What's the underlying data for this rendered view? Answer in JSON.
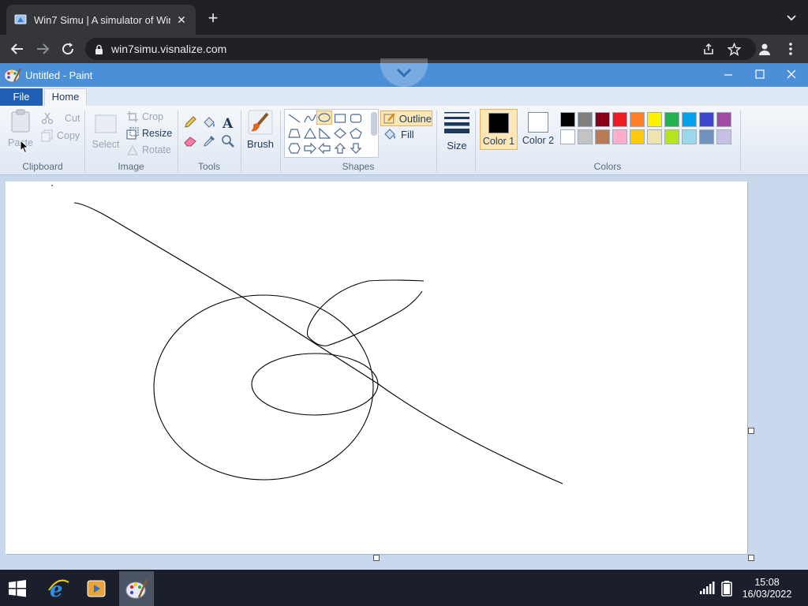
{
  "browser": {
    "tab_title": "Win7 Simu | A simulator of Win",
    "tab_close": "✕",
    "new_tab": "+",
    "url": "win7simu.visnalize.com"
  },
  "paint": {
    "window_title": "Untitled - Paint",
    "menu": {
      "file": "File",
      "home": "Home"
    },
    "clipboard": {
      "paste": "Paste",
      "cut": "Cut",
      "copy": "Copy",
      "label": "Clipboard"
    },
    "image": {
      "select": "Select",
      "crop": "Crop",
      "resize": "Resize",
      "rotate": "Rotate",
      "label": "Image"
    },
    "tools": {
      "label": "Tools"
    },
    "brush": {
      "label": "Brush"
    },
    "shapes": {
      "label": "Shapes",
      "outline": "Outline",
      "fill": "Fill"
    },
    "size": {
      "label": "Size"
    },
    "colors": {
      "color1_label": "Color 1",
      "color2_label": "Color 2",
      "label": "Colors",
      "color1": "#000000",
      "color2": "#ffffff",
      "palette_row1": [
        "#000000",
        "#7f7f7f",
        "#880015",
        "#ed1c24",
        "#ff7f27",
        "#fff200",
        "#22b14c",
        "#00a2e8",
        "#3f48cc",
        "#a349a4"
      ],
      "palette_row2": [
        "#ffffff",
        "#c3c3c3",
        "#b97a57",
        "#ffaec9",
        "#ffc90e",
        "#efe4b0",
        "#b5e61d",
        "#99d9ea",
        "#7092be",
        "#c8bfe7"
      ]
    }
  },
  "taskbar": {
    "time": "15:08",
    "date": "16/03/2022"
  }
}
